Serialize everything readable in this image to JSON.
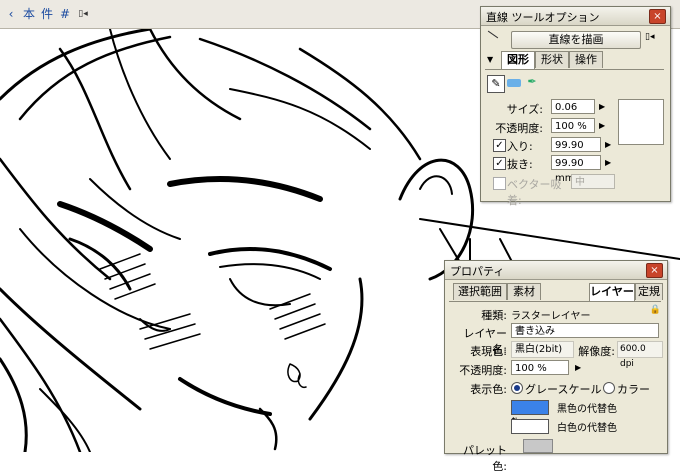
{
  "toolbar": {
    "icon1": "‹",
    "icon2": "本",
    "icon3": "件",
    "icon4": "#",
    "icon5": "▯◂"
  },
  "tool_panel": {
    "title": "直線 ツールオプション",
    "close": "×",
    "draw_button": "直線を描画",
    "menu_icon": "▯◂",
    "tabs": [
      "図形",
      "形状",
      "操作"
    ],
    "size_label": "サイズ:",
    "size_value": "0.06 mm",
    "opacity_label": "不透明度:",
    "opacity_value": "100 %",
    "in_label": "入り:",
    "in_value": "99.90 mm",
    "out_label": "抜き:",
    "out_value": "99.90 mm",
    "vector_label": "ベクター吸着:",
    "vector_value": "中",
    "checkmark": "✓"
  },
  "prop_panel": {
    "title": "プロパティ",
    "close": "×",
    "tabs": [
      "選択範囲",
      "素材",
      "レイヤー",
      "定規"
    ],
    "type_label": "種類:",
    "type_value": "ラスターレイヤー",
    "name_label": "レイヤー名:",
    "name_value": "書き込み",
    "color_label": "表現色:",
    "color_value": "黒白(2bit)",
    "res_label": "解像度:",
    "res_value": "600.0 dpi",
    "opacity_label": "不透明度:",
    "opacity_value": "100 %",
    "display_label": "表示色:",
    "gray_label": "グレースケール",
    "color_opt_label": "カラー",
    "black_sub": "黒色の代替色",
    "white_sub": "白色の代替色",
    "palette_label": "パレット色:"
  },
  "colors": {
    "black_substitute": "#3b82e8",
    "white_substitute": "#ffffff",
    "palette": "#c8c8c8"
  }
}
